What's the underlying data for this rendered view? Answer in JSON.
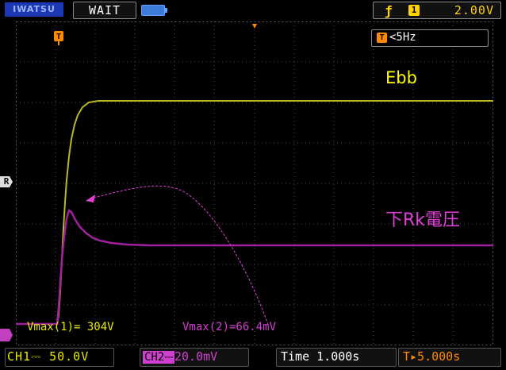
{
  "header": {
    "brand": "IWATSU",
    "run_state": "WAIT",
    "trigger_source": "1",
    "trigger_level": "2.00V"
  },
  "trigger_freq": "<5Hz",
  "trigger_marker": "T",
  "ref_marker": "R",
  "annotations": {
    "ebb": "Ebb",
    "rk": "下Rk電圧"
  },
  "measurements": {
    "vmax1": "Vmax(1)= 304V",
    "vmax2": "Vmax(2)=66.4mV"
  },
  "footer": {
    "ch1": "CH1⎓  50.0V",
    "ch2_tag": "CH2⎓",
    "ch2_value": "20.0mV",
    "time": "Time 1.000s",
    "trigger_pos": "T▸5.000s"
  },
  "colors": {
    "ch1": "#e8e800",
    "ch2": "#d040d0",
    "grid": "#4a4a4a"
  }
}
